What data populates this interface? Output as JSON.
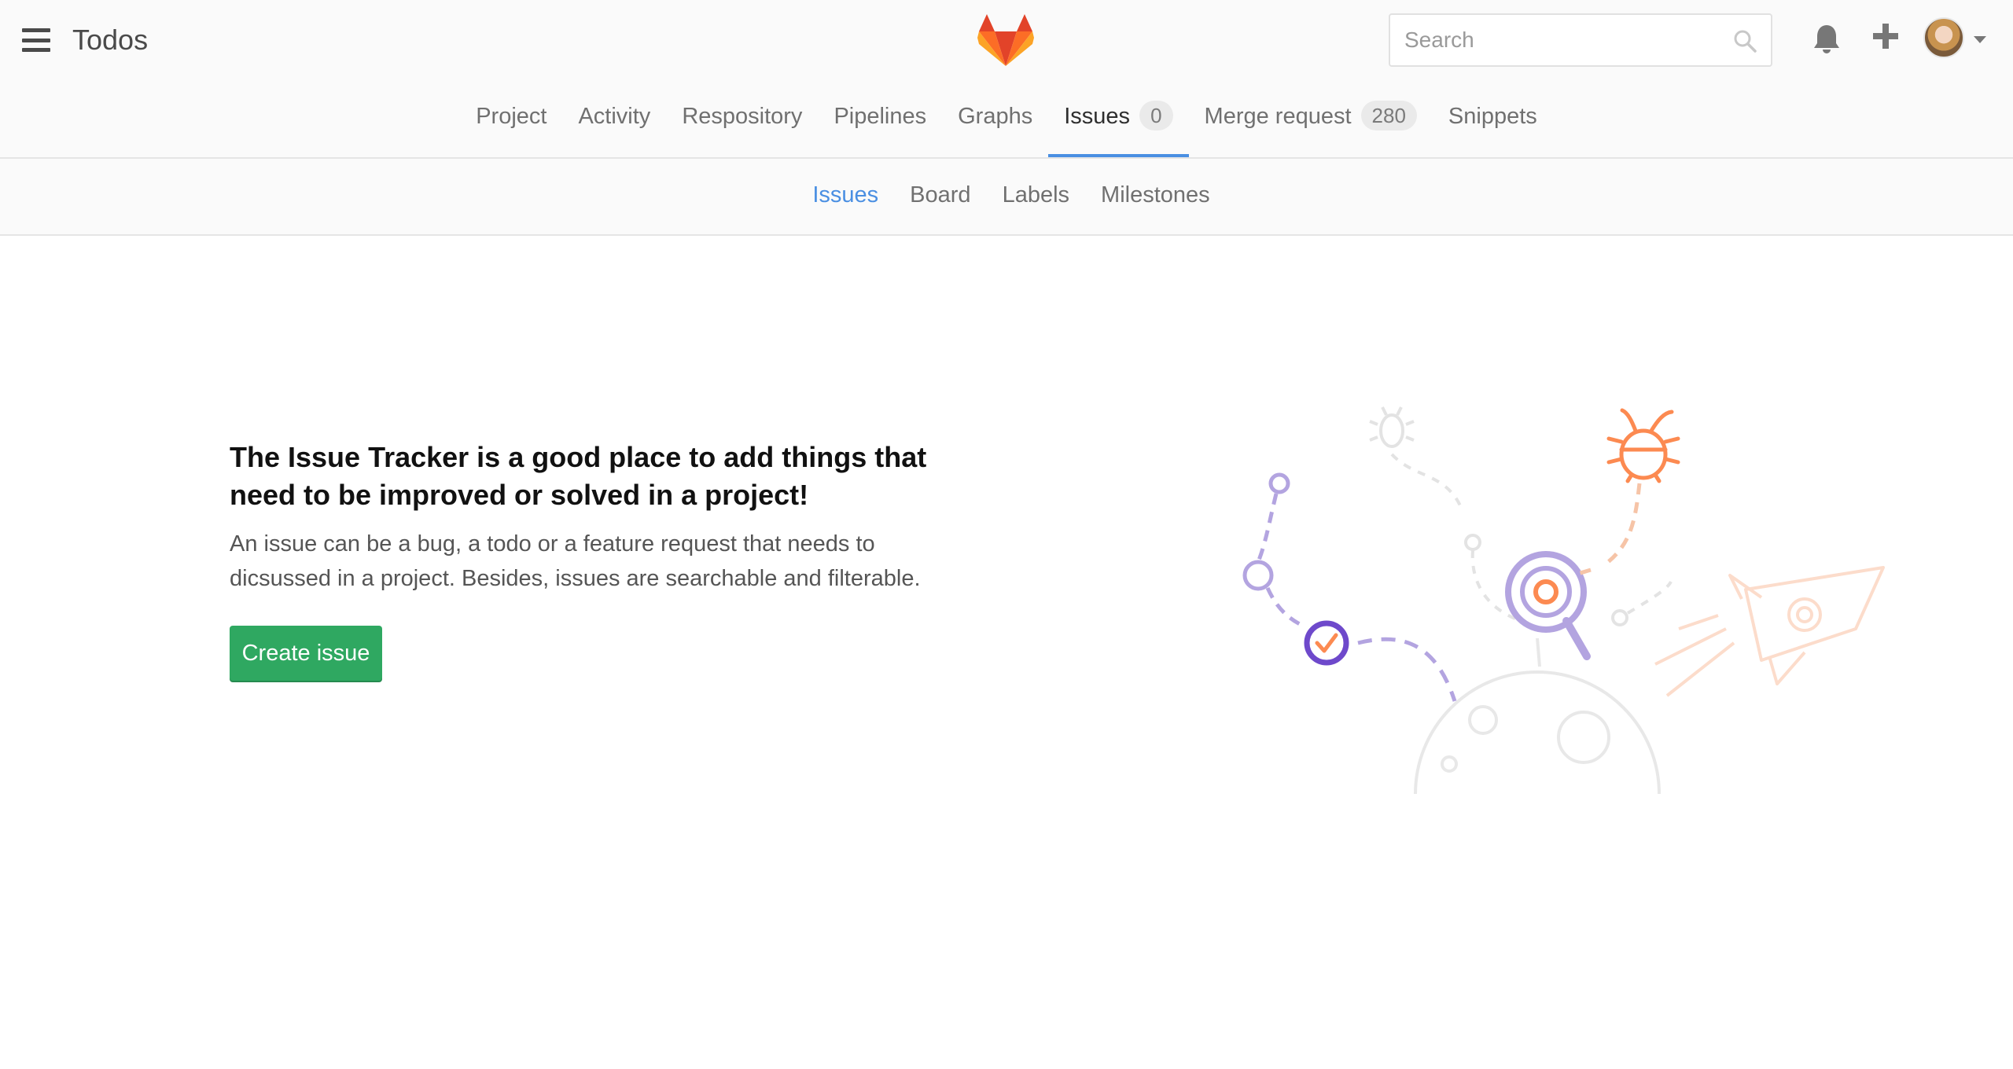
{
  "header": {
    "title": "Todos",
    "search": {
      "placeholder": "Search",
      "value": ""
    }
  },
  "nav": {
    "items": [
      {
        "label": "Project"
      },
      {
        "label": "Activity"
      },
      {
        "label": "Respository"
      },
      {
        "label": "Pipelines"
      },
      {
        "label": "Graphs"
      },
      {
        "label": "Issues",
        "badge": "0",
        "active": true
      },
      {
        "label": "Merge request",
        "badge": "280"
      },
      {
        "label": "Snippets"
      }
    ]
  },
  "subnav": {
    "items": [
      {
        "label": "Issues",
        "active": true
      },
      {
        "label": "Board"
      },
      {
        "label": "Labels"
      },
      {
        "label": "Milestones"
      }
    ]
  },
  "empty_state": {
    "title": "The Issue Tracker is a good place to add things that need to be improved or solved in a project!",
    "text": "An issue can be a bug, a todo or a feature request that needs to dicsussed in a project. Besides, issues are searchable and filterable.",
    "button": "Create issue"
  },
  "icons": {
    "menu": "hamburger-icon",
    "logo": "gitlab-fox-logo",
    "search": "search-icon",
    "notifications": "bell-icon",
    "new": "plus-icon",
    "user": "avatar",
    "dropdown": "caret-down-icon"
  },
  "colors": {
    "accent": "#4a8fe2",
    "button": "#2fa861",
    "purple": "#6e49cb",
    "orange": "#fc8a51"
  }
}
